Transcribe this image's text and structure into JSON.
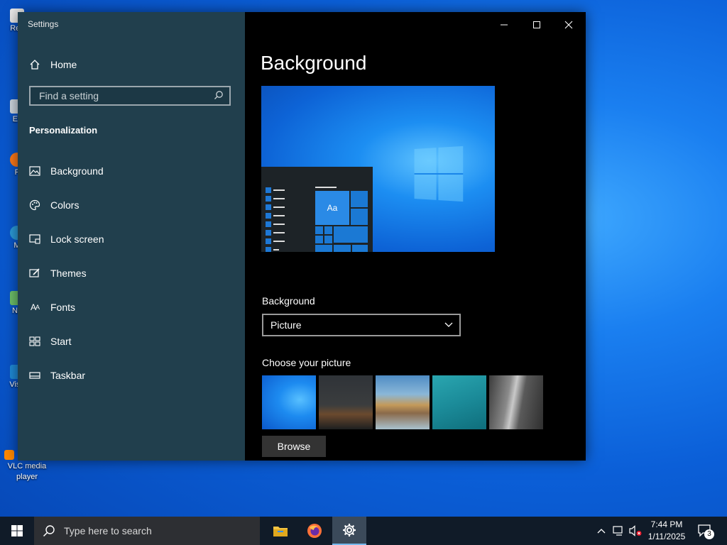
{
  "desktop": {
    "icons": [
      {
        "label": "Rec",
        "icon": "recycle-bin-icon"
      },
      {
        "label": "Ev",
        "icon": "shortcut-icon"
      },
      {
        "label": "F",
        "icon": "firefox-icon"
      },
      {
        "label": "M",
        "icon": "edge-icon"
      },
      {
        "label": "No",
        "icon": "notepad-icon"
      },
      {
        "label": "Visu",
        "icon": "vscode-icon"
      },
      {
        "label": "VLC media player",
        "icon": "vlc-icon"
      }
    ]
  },
  "window": {
    "title": "Settings",
    "sidebar": {
      "home_label": "Home",
      "search_placeholder": "Find a setting",
      "section_title": "Personalization",
      "items": [
        {
          "label": "Background",
          "icon": "picture-icon"
        },
        {
          "label": "Colors",
          "icon": "palette-icon"
        },
        {
          "label": "Lock screen",
          "icon": "lock-screen-icon"
        },
        {
          "label": "Themes",
          "icon": "brush-icon"
        },
        {
          "label": "Fonts",
          "icon": "font-icon"
        },
        {
          "label": "Start",
          "icon": "start-icon"
        },
        {
          "label": "Taskbar",
          "icon": "taskbar-icon"
        }
      ]
    },
    "content": {
      "page_title": "Background",
      "preview_sample_text": "Aa",
      "background_label": "Background",
      "background_value": "Picture",
      "choose_label": "Choose your picture",
      "browse_label": "Browse"
    }
  },
  "taskbar": {
    "search_placeholder": "Type here to search",
    "time": "7:44 PM",
    "date": "1/11/2025",
    "notification_count": "3"
  },
  "colors": {
    "sidebar_bg": "#213f4d",
    "content_bg": "#000000",
    "accent": "#0078d7"
  }
}
